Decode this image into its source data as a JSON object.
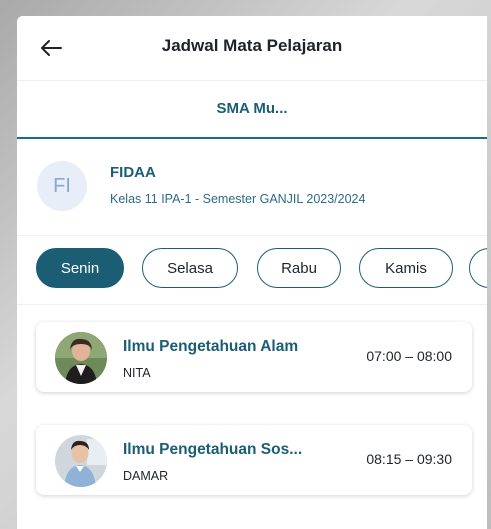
{
  "appbar": {
    "title": "Jadwal Mata Pelajaran"
  },
  "tabs": [
    {
      "label": "SMA Mu..."
    }
  ],
  "student": {
    "initials": "FI",
    "name": "FIDAA",
    "class_info": "Kelas 11 IPA-1 - Semester GANJIL 2023/2024"
  },
  "days": [
    {
      "label": "Senin",
      "active": true
    },
    {
      "label": "Selasa",
      "active": false
    },
    {
      "label": "Rabu",
      "active": false
    },
    {
      "label": "Kamis",
      "active": false
    }
  ],
  "schedule": [
    {
      "subject": "Ilmu Pengetahuan Alam",
      "teacher": "NITA",
      "time": "07:00  –  08:00"
    },
    {
      "subject": "Ilmu Pengetahuan Sos...",
      "teacher": "DAMAR",
      "time": "08:15  –  09:30"
    }
  ],
  "colors": {
    "primary": "#1b5e74",
    "avatar_bg": "#e8eef7"
  }
}
